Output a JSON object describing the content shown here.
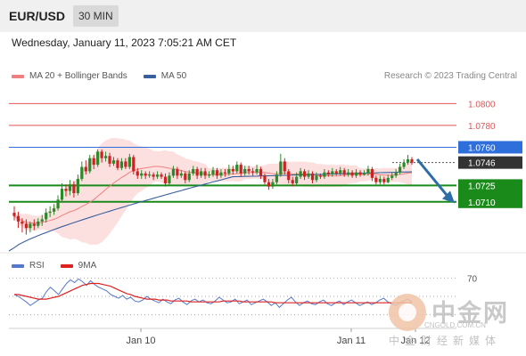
{
  "header": {
    "symbol": "EUR/USD",
    "timeframe": "30 MIN"
  },
  "datetime": "Wednesday, January 11, 2023 7:05:21 AM CET",
  "legend": [
    {
      "label": "MA 20 + Bollinger Bands",
      "color": "#f08080"
    },
    {
      "label": "MA 50",
      "color": "#3a5f9e"
    }
  ],
  "research": "Research © 2023 Trading Central",
  "colors": {
    "up": "#2a8a2a",
    "down": "#cc2222",
    "ma20": "#f08080",
    "ma50": "#3a5f9e",
    "band_fill": "#fbd6d6",
    "resistance": "#e05555",
    "support": "#1a8a1a",
    "arrow": "#2e6ea6",
    "pivot": "#2f6fdc",
    "price_tag": "#333333",
    "rsi": "#5577cc",
    "ma9": "#dd2222"
  },
  "chart_data": [
    {
      "type": "candlestick",
      "title": "",
      "x_tick_labels": [
        "Jan 10",
        "Jan 11",
        "Jan 12"
      ],
      "ylim": [
        1.0665,
        1.0815
      ],
      "levels": [
        {
          "value": 1.08,
          "label": "1.0800",
          "kind": "resistance"
        },
        {
          "value": 1.078,
          "label": "1.0780",
          "kind": "resistance"
        },
        {
          "value": 1.076,
          "label": "1.0760",
          "kind": "pivot"
        },
        {
          "value": 1.0746,
          "label": "1.0746",
          "kind": "last"
        },
        {
          "value": 1.0725,
          "label": "1.0725",
          "kind": "support"
        },
        {
          "value": 1.071,
          "label": "1.0710",
          "kind": "support"
        }
      ],
      "arrow": {
        "from": 1.0749,
        "to": 1.0712,
        "direction": "down"
      },
      "candles": [
        [
          1.07,
          1.0697,
          1.0706,
          1.0693
        ],
        [
          1.0697,
          1.0692,
          1.0701,
          1.0686
        ],
        [
          1.0692,
          1.069,
          1.0695,
          1.0682
        ],
        [
          1.069,
          1.0686,
          1.0694,
          1.068
        ],
        [
          1.0686,
          1.069,
          1.0692,
          1.0682
        ],
        [
          1.069,
          1.0688,
          1.0694,
          1.0684
        ],
        [
          1.0688,
          1.0692,
          1.0695,
          1.0686
        ],
        [
          1.0692,
          1.0694,
          1.0698,
          1.0688
        ],
        [
          1.0694,
          1.07,
          1.0704,
          1.0691
        ],
        [
          1.07,
          1.0701,
          1.0706,
          1.0696
        ],
        [
          1.0701,
          1.0704,
          1.0708,
          1.0698
        ],
        [
          1.0704,
          1.0712,
          1.0716,
          1.0702
        ],
        [
          1.0712,
          1.0722,
          1.0727,
          1.071
        ],
        [
          1.0722,
          1.072,
          1.0726,
          1.0715
        ],
        [
          1.072,
          1.0726,
          1.073,
          1.0716
        ],
        [
          1.0726,
          1.0718,
          1.0729,
          1.0714
        ],
        [
          1.0718,
          1.0731,
          1.0735,
          1.0716
        ],
        [
          1.0731,
          1.0742,
          1.0747,
          1.0729
        ],
        [
          1.0742,
          1.0738,
          1.0748,
          1.0735
        ],
        [
          1.0738,
          1.075,
          1.0753,
          1.0736
        ],
        [
          1.075,
          1.0744,
          1.0753,
          1.074
        ],
        [
          1.0744,
          1.0756,
          1.0758,
          1.0742
        ],
        [
          1.0756,
          1.075,
          1.0758,
          1.0746
        ],
        [
          1.075,
          1.0752,
          1.0756,
          1.0747
        ],
        [
          1.0752,
          1.0745,
          1.0755,
          1.0742
        ],
        [
          1.0745,
          1.0748,
          1.0751,
          1.0743
        ],
        [
          1.0748,
          1.0741,
          1.075,
          1.0739
        ],
        [
          1.0741,
          1.0747,
          1.075,
          1.0739
        ],
        [
          1.0747,
          1.0742,
          1.075,
          1.074
        ],
        [
          1.0742,
          1.0751,
          1.0754,
          1.074
        ],
        [
          1.0751,
          1.0738,
          1.0753,
          1.0735
        ],
        [
          1.0738,
          1.0734,
          1.0741,
          1.0731
        ],
        [
          1.0734,
          1.0736,
          1.0739,
          1.0731
        ],
        [
          1.0736,
          1.0734,
          1.0738,
          1.0731
        ],
        [
          1.0734,
          1.0735,
          1.0738,
          1.0732
        ],
        [
          1.0735,
          1.0733,
          1.0737,
          1.073
        ],
        [
          1.0733,
          1.0735,
          1.0738,
          1.0731
        ],
        [
          1.0735,
          1.0733,
          1.0737,
          1.0731
        ],
        [
          1.0733,
          1.0727,
          1.0736,
          1.0724
        ],
        [
          1.0727,
          1.0734,
          1.0737,
          1.0725
        ],
        [
          1.0734,
          1.074,
          1.0743,
          1.0732
        ],
        [
          1.074,
          1.0734,
          1.0742,
          1.0731
        ],
        [
          1.0734,
          1.0736,
          1.0739,
          1.0732
        ],
        [
          1.0736,
          1.073,
          1.0738,
          1.0727
        ],
        [
          1.073,
          1.0736,
          1.0739,
          1.0728
        ],
        [
          1.0736,
          1.074,
          1.0743,
          1.0734
        ],
        [
          1.074,
          1.0734,
          1.0742,
          1.0731
        ],
        [
          1.0734,
          1.0738,
          1.0741,
          1.0732
        ],
        [
          1.0738,
          1.0734,
          1.0741,
          1.0731
        ],
        [
          1.0734,
          1.0735,
          1.0738,
          1.0732
        ],
        [
          1.0735,
          1.0739,
          1.0742,
          1.0733
        ],
        [
          1.0739,
          1.0734,
          1.0741,
          1.0731
        ],
        [
          1.0734,
          1.0737,
          1.074,
          1.0732
        ],
        [
          1.0737,
          1.0736,
          1.074,
          1.0733
        ],
        [
          1.0736,
          1.074,
          1.0744,
          1.0734
        ],
        [
          1.074,
          1.0738,
          1.0743,
          1.0735
        ],
        [
          1.0738,
          1.0744,
          1.0747,
          1.0736
        ],
        [
          1.0744,
          1.0736,
          1.0746,
          1.0733
        ],
        [
          1.0736,
          1.074,
          1.0743,
          1.0734
        ],
        [
          1.074,
          1.0738,
          1.0743,
          1.0735
        ],
        [
          1.0738,
          1.0737,
          1.0741,
          1.0734
        ],
        [
          1.0737,
          1.074,
          1.0744,
          1.0735
        ],
        [
          1.074,
          1.0734,
          1.0742,
          1.0731
        ],
        [
          1.0734,
          1.0728,
          1.0736,
          1.0726
        ],
        [
          1.0728,
          1.0724,
          1.0731,
          1.0721
        ],
        [
          1.0724,
          1.0728,
          1.0731,
          1.0722
        ],
        [
          1.0728,
          1.0735,
          1.0738,
          1.0726
        ],
        [
          1.0735,
          1.0747,
          1.0754,
          1.0733
        ],
        [
          1.0747,
          1.0738,
          1.075,
          1.0735
        ],
        [
          1.0738,
          1.073,
          1.074,
          1.0727
        ],
        [
          1.073,
          1.0727,
          1.0733,
          1.0724
        ],
        [
          1.0727,
          1.0733,
          1.0737,
          1.0725
        ],
        [
          1.0733,
          1.0738,
          1.0741,
          1.0731
        ],
        [
          1.0738,
          1.0733,
          1.074,
          1.073
        ],
        [
          1.0733,
          1.0736,
          1.0739,
          1.0731
        ],
        [
          1.0736,
          1.073,
          1.0738,
          1.0727
        ],
        [
          1.073,
          1.0734,
          1.0737,
          1.0728
        ],
        [
          1.0734,
          1.0733,
          1.0736,
          1.0731
        ],
        [
          1.0733,
          1.0737,
          1.074,
          1.0731
        ],
        [
          1.0737,
          1.0735,
          1.0739,
          1.0733
        ],
        [
          1.0735,
          1.0738,
          1.0741,
          1.0733
        ],
        [
          1.0738,
          1.0736,
          1.074,
          1.0734
        ],
        [
          1.0736,
          1.0739,
          1.0742,
          1.0734
        ],
        [
          1.0739,
          1.0735,
          1.0741,
          1.0733
        ],
        [
          1.0735,
          1.0737,
          1.074,
          1.0733
        ],
        [
          1.0737,
          1.0734,
          1.0739,
          1.0732
        ],
        [
          1.0734,
          1.0737,
          1.074,
          1.0732
        ],
        [
          1.0737,
          1.0735,
          1.0739,
          1.0733
        ],
        [
          1.0735,
          1.0736,
          1.0739,
          1.0734
        ],
        [
          1.0736,
          1.074,
          1.0743,
          1.0734
        ],
        [
          1.074,
          1.0732,
          1.0742,
          1.0729
        ],
        [
          1.0732,
          1.0728,
          1.0734,
          1.0726
        ],
        [
          1.0728,
          1.0731,
          1.0734,
          1.0726
        ],
        [
          1.0731,
          1.0728,
          1.0733,
          1.0726
        ],
        [
          1.0728,
          1.0732,
          1.0735,
          1.0727
        ],
        [
          1.0732,
          1.0734,
          1.0737,
          1.073
        ],
        [
          1.0734,
          1.0737,
          1.074,
          1.0732
        ],
        [
          1.0737,
          1.0742,
          1.0745,
          1.0735
        ],
        [
          1.0742,
          1.0746,
          1.0749,
          1.074
        ],
        [
          1.0746,
          1.0749,
          1.0753,
          1.0744
        ],
        [
          1.0749,
          1.0746,
          1.0751,
          1.0744
        ]
      ]
    },
    {
      "type": "line",
      "title": "",
      "series": [
        {
          "name": "RSI"
        },
        {
          "name": "9MA"
        }
      ],
      "ylim": [
        20,
        80
      ],
      "y_tick_labels": [
        "70"
      ],
      "rsi": [
        52,
        50,
        47,
        44,
        40,
        43,
        46,
        48,
        55,
        60,
        56,
        52,
        58,
        64,
        68,
        65,
        69,
        66,
        62,
        67,
        63,
        60,
        58,
        56,
        52,
        50,
        48,
        51,
        47,
        49,
        45,
        44,
        46,
        50,
        47,
        45,
        43,
        47,
        44,
        42,
        46,
        48,
        44,
        41,
        45,
        47,
        44,
        46,
        43,
        42,
        45,
        49,
        46,
        43,
        44,
        47,
        42,
        44,
        46,
        41,
        43,
        45,
        47,
        44,
        40,
        43,
        38,
        42,
        46,
        49,
        44,
        40,
        43,
        45,
        42,
        41,
        44,
        46,
        42,
        40,
        43,
        45,
        41,
        44,
        46,
        43,
        40,
        42,
        44,
        41,
        43,
        46,
        48,
        44,
        42,
        40,
        43,
        45,
        47,
        44
      ],
      "ma9": [
        52,
        52,
        51,
        50,
        49,
        48,
        47,
        47,
        47,
        48,
        49,
        50,
        52,
        54,
        56,
        58,
        60,
        62,
        63,
        64,
        64,
        64,
        63,
        62,
        61,
        59,
        57,
        55,
        53,
        52,
        50,
        49,
        48,
        47,
        47,
        47,
        46,
        46,
        46,
        45,
        45,
        45,
        45,
        45,
        44,
        44,
        44,
        44,
        44,
        44,
        44,
        44,
        45,
        45,
        45,
        45,
        45,
        44,
        44,
        44,
        44,
        44,
        44,
        44,
        44,
        43,
        43,
        43,
        43,
        43,
        43,
        43,
        43,
        43,
        43,
        43,
        43,
        43,
        43,
        43,
        43,
        43,
        43,
        43,
        43,
        43,
        43,
        43,
        43,
        43,
        43,
        43,
        43,
        43,
        43,
        43,
        43,
        43,
        43,
        43
      ]
    }
  ],
  "watermark": {
    "name": "中金网",
    "url": "CNGOLD.COM.CN",
    "tagline": "中金财经新媒体"
  }
}
